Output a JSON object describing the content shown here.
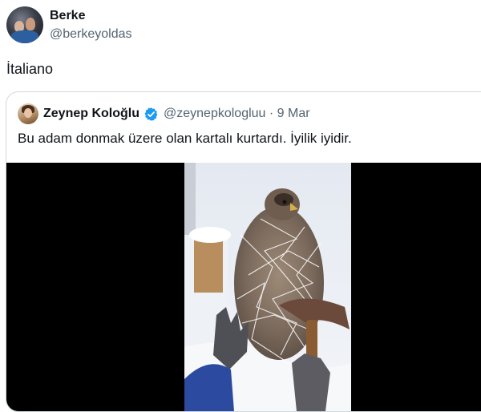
{
  "tweet": {
    "author_name": "Berke",
    "author_handle": "@berkeyoldas",
    "text": "İtaliano"
  },
  "quoted": {
    "author_name": "Zeynep Koloğlu",
    "author_handle": "@zeynepkologluu · 9 Mar",
    "text": "Bu adam donmak üzere olan kartalı kurtardı. İyilik iyidir.",
    "verified_icon": "verified-badge-icon",
    "accent_color": "#1d9bf0"
  },
  "media": {
    "type": "video-thumbnail",
    "subject": "eagle-in-snow-icon"
  }
}
